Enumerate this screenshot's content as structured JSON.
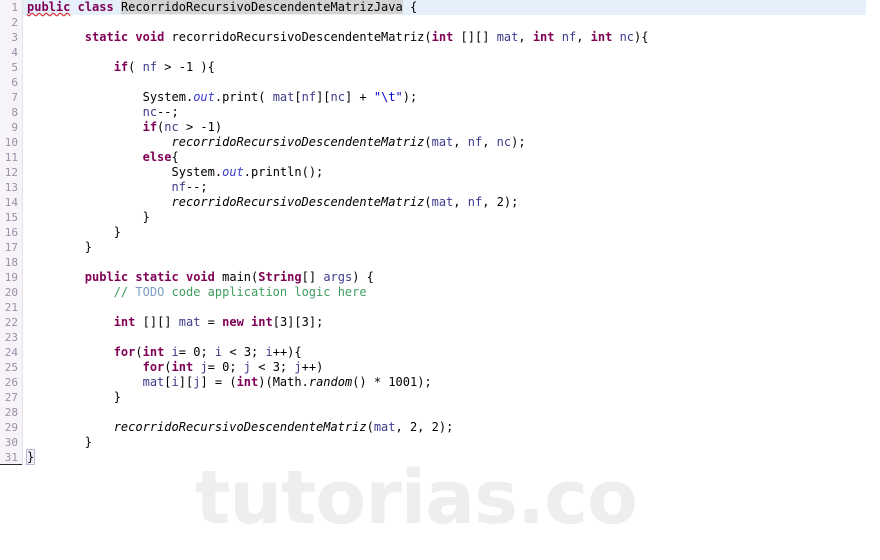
{
  "editor": {
    "language": "java",
    "watermark": "tutorias.co",
    "first_line_highlighted": true,
    "line_count": 31,
    "colors": {
      "background": "#ffffff",
      "gutter_background": "#f7f4f9",
      "gutter_text": "#9a90a6",
      "current_line_highlight": "#e6f0fb",
      "keyword": "#7f0055",
      "string": "#0000d0",
      "comment": "#3f9f5f",
      "todo_tag": "#7a9ec2",
      "static_field": "#3a3ad0",
      "parameter": "#3c3c8c",
      "occurrence_highlight": "#d4d4d4",
      "watermark": "#eeeeee",
      "error_squiggle": "#dd3333"
    }
  },
  "gutter": {
    "numbers": [
      1,
      2,
      3,
      4,
      5,
      6,
      7,
      8,
      9,
      10,
      11,
      12,
      13,
      14,
      15,
      16,
      17,
      18,
      19,
      20,
      21,
      22,
      23,
      24,
      25,
      26,
      27,
      28,
      29,
      30,
      31
    ]
  },
  "code": {
    "plain_text": "public class RecorridoRecursivoDescendenteMatrizJava {\n\n        static void recorridoRecursivoDescendenteMatriz(int [][] mat, int nf, int nc){\n\n            if( nf > -1 ){\n\n                System.out.print( mat[nf][nc] + \"\\t\");\n                nc--;\n                if(nc > -1)\n                    recorridoRecursivoDescendenteMatriz(mat, nf, nc);\n                else{\n                    System.out.println();\n                    nf--;\n                    recorridoRecursivoDescendenteMatriz(mat, nf, 2);\n                }\n            }\n        }\n\n        public static void main(String[] args) {\n            // TODO code application logic here\n\n            int [][] mat = new int[3][3];\n\n            for(int i= 0; i < 3; i++){\n                for(int j= 0; j < 3; j++)\n                mat[i][j] = (int)(Math.random() * 1001);\n            }\n\n            recorridoRecursivoDescendenteMatriz(mat, 2, 2);\n        }\n}",
    "lines": [
      {
        "n": 1,
        "text": "public class RecorridoRecursivoDescendenteMatrizJava {"
      },
      {
        "n": 2,
        "text": ""
      },
      {
        "n": 3,
        "text": "        static void recorridoRecursivoDescendenteMatriz(int [][] mat, int nf, int nc){"
      },
      {
        "n": 4,
        "text": ""
      },
      {
        "n": 5,
        "text": "            if( nf > -1 ){"
      },
      {
        "n": 6,
        "text": ""
      },
      {
        "n": 7,
        "text": "                System.out.print( mat[nf][nc] + \"\\t\");"
      },
      {
        "n": 8,
        "text": "                nc--;"
      },
      {
        "n": 9,
        "text": "                if(nc > -1)"
      },
      {
        "n": 10,
        "text": "                    recorridoRecursivoDescendenteMatriz(mat, nf, nc);"
      },
      {
        "n": 11,
        "text": "                else{"
      },
      {
        "n": 12,
        "text": "                    System.out.println();"
      },
      {
        "n": 13,
        "text": "                    nf--;"
      },
      {
        "n": 14,
        "text": "                    recorridoRecursivoDescendenteMatriz(mat, nf, 2);"
      },
      {
        "n": 15,
        "text": "                }"
      },
      {
        "n": 16,
        "text": "            }"
      },
      {
        "n": 17,
        "text": "        }"
      },
      {
        "n": 18,
        "text": ""
      },
      {
        "n": 19,
        "text": "        public static void main(String[] args) {"
      },
      {
        "n": 20,
        "text": "            // TODO code application logic here"
      },
      {
        "n": 21,
        "text": ""
      },
      {
        "n": 22,
        "text": "            int [][] mat = new int[3][3];"
      },
      {
        "n": 23,
        "text": ""
      },
      {
        "n": 24,
        "text": "            for(int i= 0; i < 3; i++){"
      },
      {
        "n": 25,
        "text": "                for(int j= 0; j < 3; j++)"
      },
      {
        "n": 26,
        "text": "                mat[i][j] = (int)(Math.random() * 1001);"
      },
      {
        "n": 27,
        "text": "            }"
      },
      {
        "n": 28,
        "text": ""
      },
      {
        "n": 29,
        "text": "            recorridoRecursivoDescendenteMatriz(mat, 2, 2);"
      },
      {
        "n": 30,
        "text": "        }"
      },
      {
        "n": 31,
        "text": "}"
      }
    ]
  }
}
